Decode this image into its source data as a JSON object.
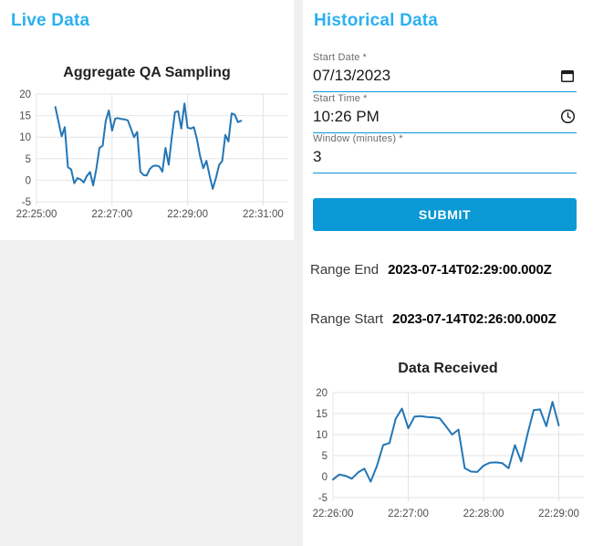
{
  "colors": {
    "heading": "#2bb0f0",
    "primary": "#0b99d6",
    "line": "#2376b5",
    "grid": "#e4e4e4",
    "tick": "#4d4d4d",
    "chart_title": "#222222",
    "page_background": "#f0f0f0",
    "card_background": "#ffffff"
  },
  "live": {
    "title": "Live Data"
  },
  "historical": {
    "title": "Historical Data",
    "fields": [
      {
        "label": "Start Date",
        "required_marker": "*",
        "value": "07/13/2023",
        "icon": "calendar-icon"
      },
      {
        "label": "Start Time",
        "required_marker": "*",
        "value": "10:26 PM",
        "icon": "clock-icon"
      },
      {
        "label": "Window (minutes)",
        "required_marker": "*",
        "value": "3",
        "icon": ""
      }
    ],
    "submit_label": "SUBMIT",
    "results": [
      {
        "label": "Range End",
        "value": "2023-07-14T02:29:00.000Z"
      },
      {
        "label": "Range Start",
        "value": "2023-07-14T02:26:00.000Z"
      }
    ]
  },
  "chart_data": [
    {
      "id": "live-chart",
      "type": "line",
      "title": "Aggregate QA Sampling",
      "xlabel": "",
      "ylabel": "",
      "grid": true,
      "legend": false,
      "ylim": [
        -5,
        20
      ],
      "y_ticks": [
        20,
        15,
        10,
        5,
        0,
        -5
      ],
      "x_tick_labels": [
        "22:25:00",
        "22:27:00",
        "22:29:00",
        "22:31:00"
      ],
      "x_tick_seconds": [
        0,
        120,
        240,
        360
      ],
      "xlim_seconds": [
        0,
        400
      ],
      "x_origin_time": "22:25:00",
      "series_start_second": 30,
      "series_step_seconds": 5,
      "values": [
        17.0,
        13.5,
        10.2,
        12.3,
        3.0,
        2.5,
        -0.7,
        0.5,
        0.2,
        -0.5,
        1.0,
        1.9,
        -1.2,
        2.5,
        7.5,
        8.0,
        13.8,
        16.2,
        11.5,
        14.3,
        14.4,
        14.2,
        14.1,
        13.9,
        12.0,
        10.0,
        11.2,
        2.0,
        1.2,
        1.1,
        2.6,
        3.3,
        3.4,
        3.2,
        2.0,
        7.5,
        3.6,
        10.0,
        15.8,
        16.0,
        12.0,
        17.8,
        12.2,
        12.0,
        12.3,
        9.5,
        5.5,
        2.8,
        4.5,
        1.0,
        -2.0,
        0.5,
        3.5,
        4.5,
        10.5,
        9.0,
        15.5,
        15.2,
        13.5,
        13.8
      ]
    },
    {
      "id": "received-chart",
      "type": "line",
      "title": "Data Received",
      "xlabel": "",
      "ylabel": "",
      "grid": true,
      "legend": false,
      "ylim": [
        -5,
        20
      ],
      "y_ticks": [
        20,
        15,
        10,
        5,
        0,
        -5
      ],
      "x_tick_labels": [
        "22:26:00",
        "22:27:00",
        "22:28:00",
        "22:29:00"
      ],
      "x_tick_seconds": [
        0,
        60,
        120,
        180
      ],
      "xlim_seconds": [
        0,
        200
      ],
      "x_origin_time": "22:26:00",
      "series_start_second": 0,
      "series_step_seconds": 5,
      "values": [
        -0.7,
        0.5,
        0.2,
        -0.5,
        1.0,
        1.9,
        -1.2,
        2.5,
        7.5,
        8.0,
        13.8,
        16.2,
        11.5,
        14.3,
        14.4,
        14.2,
        14.1,
        13.9,
        12.0,
        10.0,
        11.2,
        2.0,
        1.2,
        1.1,
        2.6,
        3.3,
        3.4,
        3.2,
        2.0,
        7.5,
        3.6,
        10.0,
        15.8,
        16.0,
        12.0,
        17.8,
        12.2
      ]
    }
  ]
}
